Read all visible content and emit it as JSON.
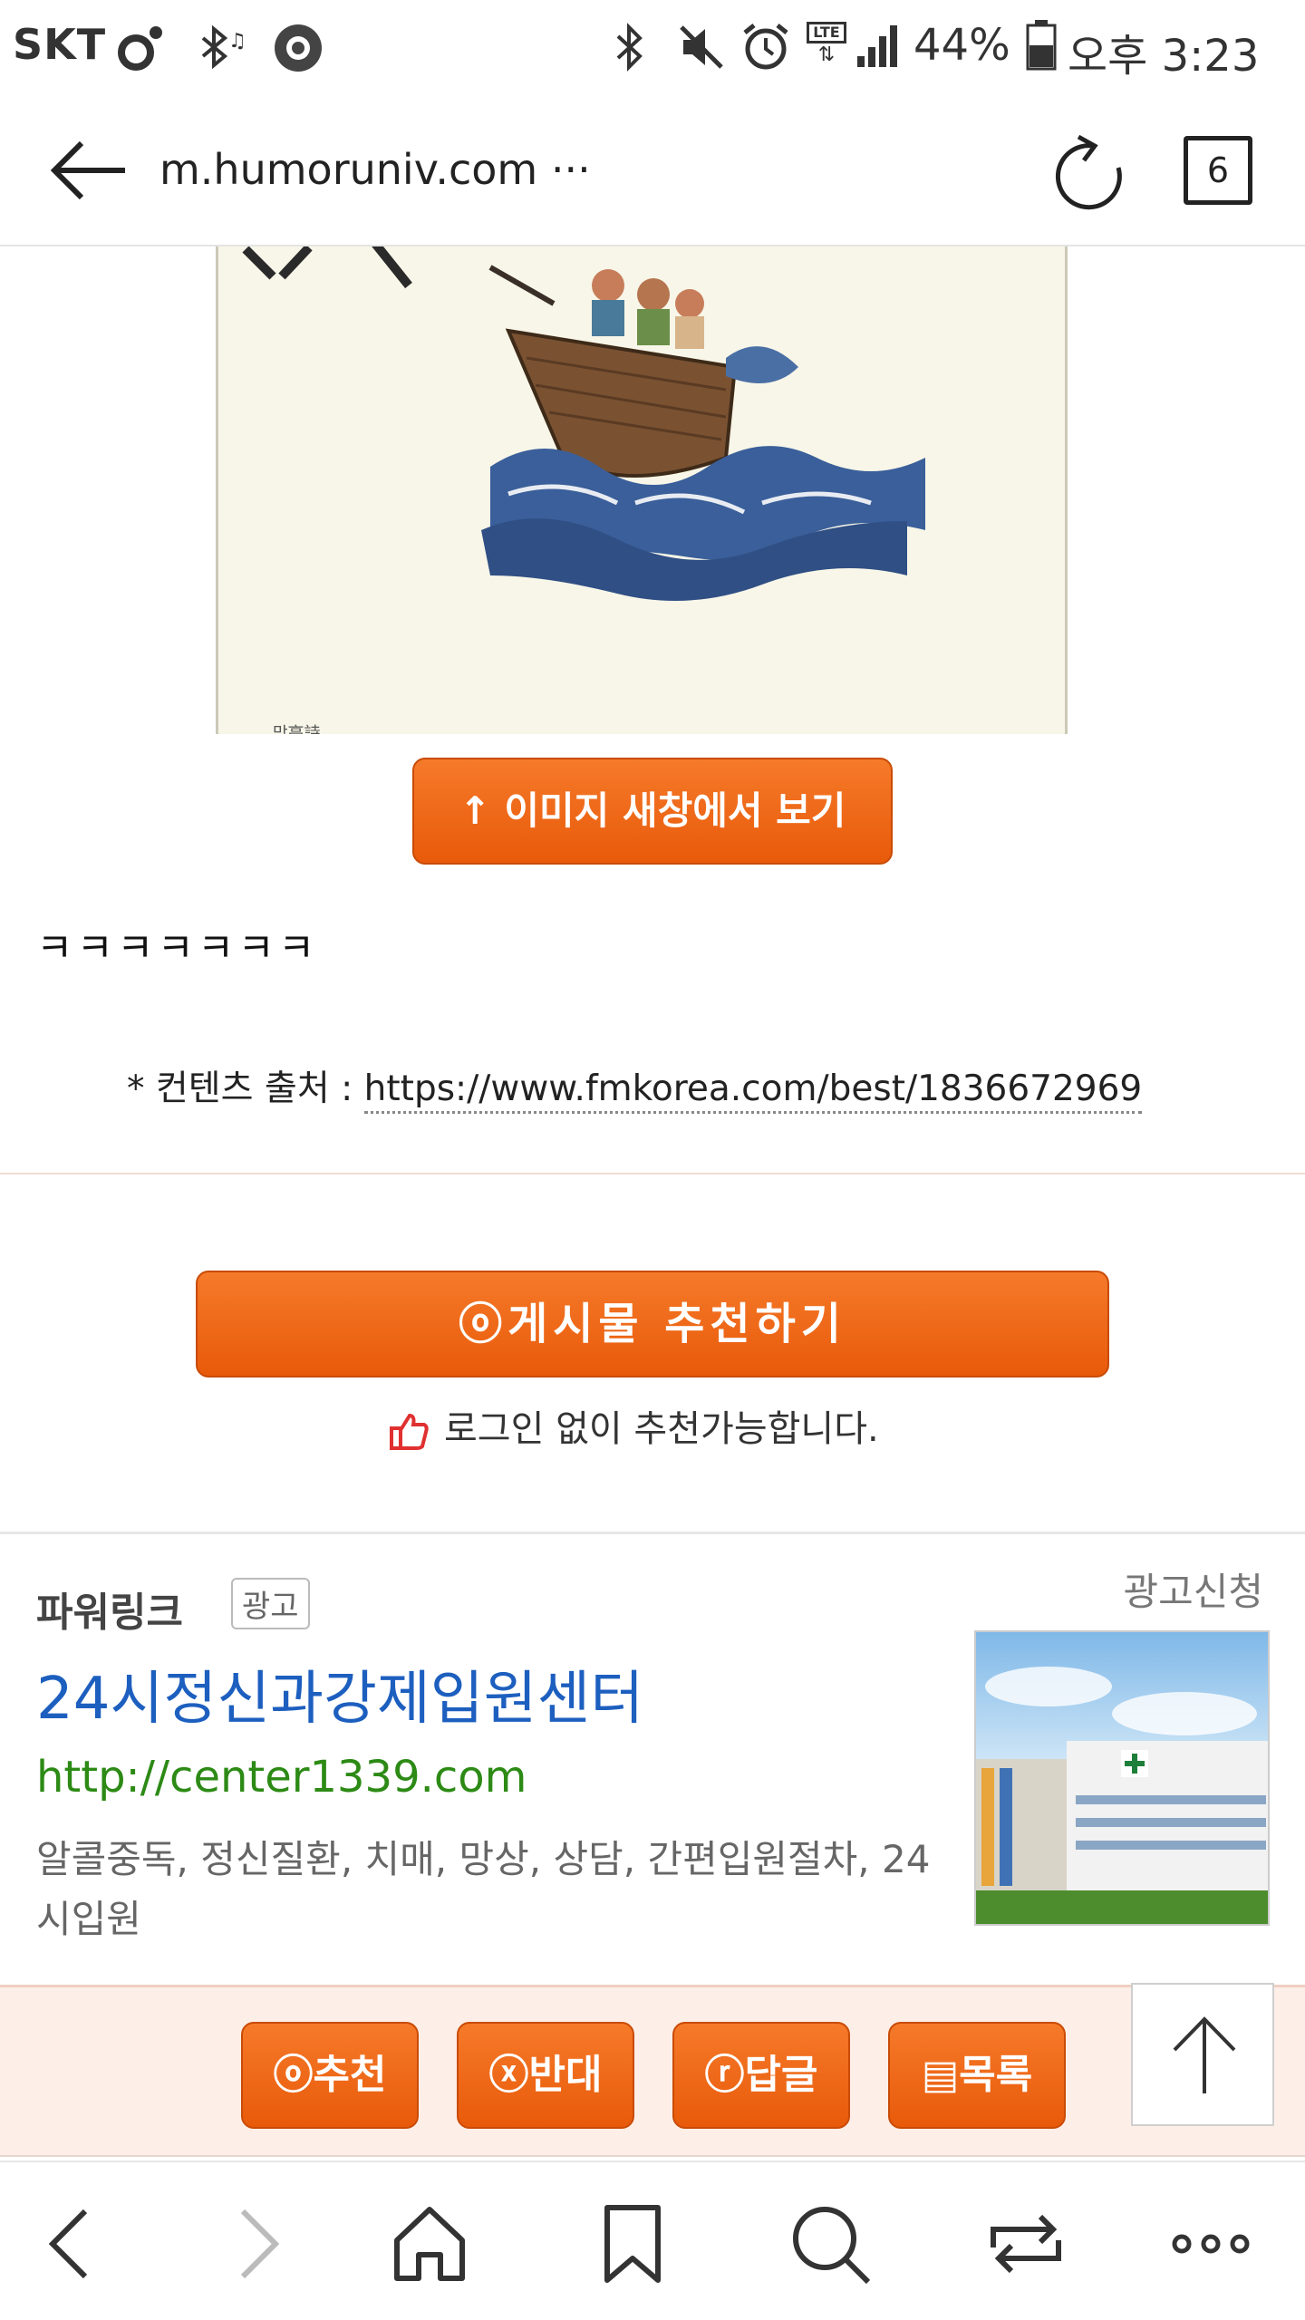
{
  "status_bar": {
    "carrier": "SKT",
    "network": "LTE",
    "battery": "44%",
    "time": "오후 3:23"
  },
  "browser": {
    "url": "m.humoruniv.com ···",
    "tab_count": "6"
  },
  "article": {
    "image_caption_small": "망高詩",
    "view_image_button": "↑ 이미지 새창에서 보기",
    "body_text": "ㅋㅋㅋㅋㅋㅋㅋ",
    "source_label": "* 컨텐츠 출처 : ",
    "source_url": "https://www.fmkorea.com/best/1836672969"
  },
  "recommend": {
    "button_label": "ⓞ게시물 추천하기",
    "note": "로그인 없이 추천가능합니다."
  },
  "ad": {
    "section_title": "파워링크",
    "badge": "광고",
    "apply_link": "광고신청",
    "title": "24시정신과강제입원센터",
    "url": "http://center1339.com",
    "description": "알콜중독, 정신질환, 치매, 망상, 상담, 간편입원절차, 24시입원"
  },
  "action_bar": {
    "buttons": [
      {
        "label": "ⓞ추천"
      },
      {
        "label": "ⓧ반대"
      },
      {
        "label": "ⓡ답글"
      },
      {
        "label": "▤목록"
      }
    ]
  },
  "colors": {
    "accent_orange": "#ee6410",
    "ad_title_blue": "#1d5fbf",
    "ad_url_green": "#2c8a15"
  },
  "icons": {
    "toolbar": [
      "back-icon",
      "forward-icon",
      "home-icon",
      "bookmark-icon",
      "search-icon",
      "tabs-switch-icon",
      "more-icon"
    ]
  }
}
